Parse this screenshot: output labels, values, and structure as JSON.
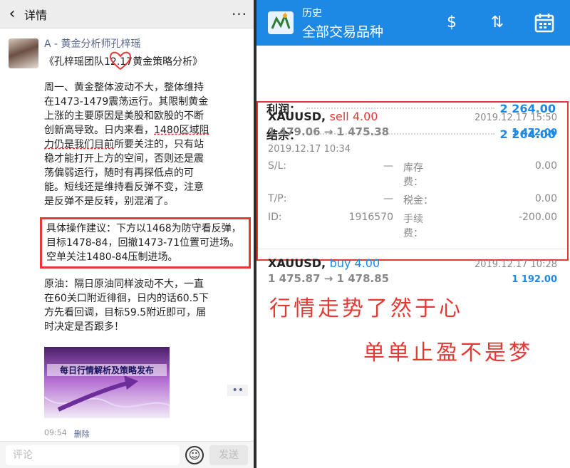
{
  "left": {
    "header": {
      "title": "详情"
    },
    "post": {
      "author": "A - 黄金分析师孔梓瑶",
      "title": "《孔梓瑶团队12.17黄金策略分析》",
      "para1_a": "周一、黄金整体波动不大，整体维持在1473-1479震荡运行。其限制黄金上涨的主要原因是美股和欧股的不断创新高导致。日内来看，",
      "para1_b": "1480区域阻力仍是我们目前",
      "para1_c": "所要关注的，只有站稳才能打开上方的空间，否则还是震荡偏弱运行，随时有再探低点的可能。短线还是维持看反弹不变，注意是反弹不是反转，别混淆了。",
      "advice": "具体操作建议：下方以1468为防守看反弹，目标1478-84，回撤1473-71位置可进场。空单关注1480-84压制进场。",
      "oil": "原油：隔日原油同样波动不大，一直在60关口附近徘徊，日内的话60.5下方先看回调，目标59.5附近即可，届时决定是否跟多！",
      "image_banner": "每日行情解析及策略发布",
      "time": "09:54",
      "delete": "删除",
      "more_dots": "••"
    },
    "comment_bar": {
      "placeholder": "评论",
      "send": "发送"
    }
  },
  "right": {
    "header": {
      "subtitle": "历史",
      "title": "全部交易品种"
    },
    "summary": [
      {
        "label": "利润：",
        "value": "2 264.00"
      },
      {
        "label": "结余：",
        "value": "2 264.00"
      }
    ],
    "trades": [
      {
        "symbol": "XAUUSD,",
        "side": "sell 4.00",
        "close_time": "2019.12.17 15:50",
        "price": "1 479.06 → 1 475.38",
        "profit": "1 472.00",
        "open_time": "2019.12.17 10:34",
        "sl_label": "S/L:",
        "sl": "—",
        "swap_label": "库存费：",
        "swap": "0.00",
        "tp_label": "T/P:",
        "tp": "—",
        "tax_label": "税金：",
        "tax": "0.00",
        "id_label": "ID:",
        "id": "1916570",
        "fee_label": "手续费：",
        "fee": "-200.00"
      },
      {
        "symbol": "XAUUSD,",
        "side": "buy 4.00",
        "close_time": "2019.12.17 10:28",
        "price": "1 475.87 → 1 478.85",
        "profit": "1 192.00"
      }
    ],
    "slogans": [
      "行情走势了然于心",
      "单单止盈不是梦"
    ],
    "colors": {
      "accent": "#1e88e5",
      "sell": "#e53935",
      "highlight_box": "#e53935"
    }
  }
}
